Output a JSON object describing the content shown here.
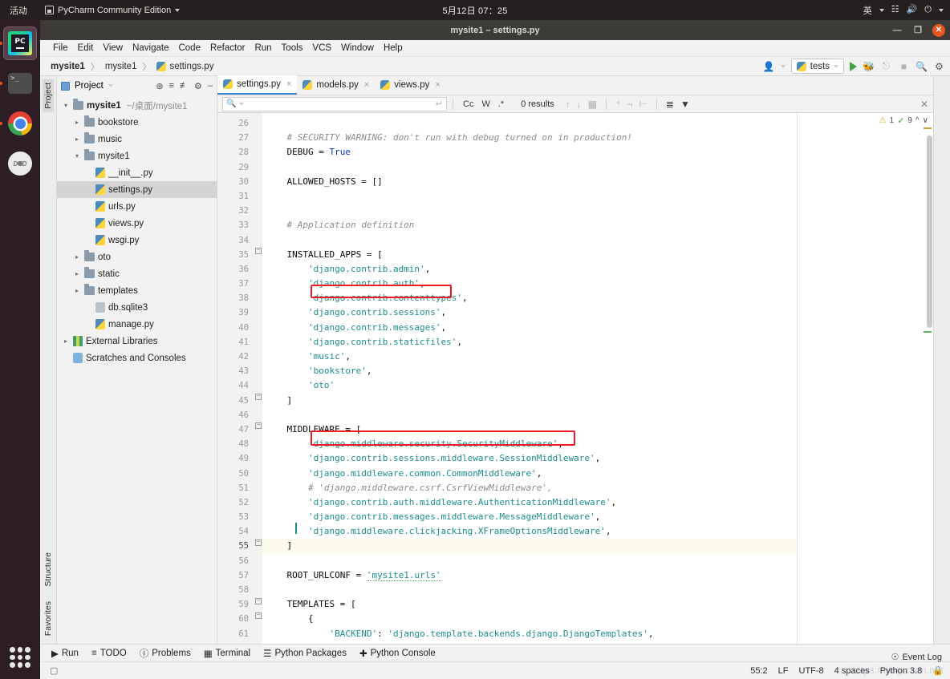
{
  "desktop": {
    "activities": "活动",
    "app_menu": "PyCharm Community Edition",
    "clock": "5月12日 07：25",
    "input_method": "英",
    "dock": [
      {
        "name": "pycharm",
        "label": "PC"
      },
      {
        "name": "terminal",
        "label": ">_"
      },
      {
        "name": "chrome",
        "label": ""
      },
      {
        "name": "dvd",
        "label": "DVD"
      }
    ]
  },
  "window": {
    "title": "mysite1 – settings.py",
    "minimize": "—",
    "maximize": "❐",
    "close": "✕"
  },
  "menu": [
    "File",
    "Edit",
    "View",
    "Navigate",
    "Code",
    "Refactor",
    "Run",
    "Tools",
    "VCS",
    "Window",
    "Help"
  ],
  "navbar": {
    "crumbs": [
      "mysite1",
      "mysite1",
      "settings.py"
    ],
    "separator": "〉",
    "run_config": "tests",
    "profile_icon": "user-icon"
  },
  "project": {
    "panel_title": "Project",
    "tree": [
      {
        "indent": 0,
        "arrow": "v",
        "icon": "folder",
        "label": "mysite1",
        "path": "~/桌面/mysite1",
        "bold": true,
        "selected": false
      },
      {
        "indent": 1,
        "arrow": ">",
        "icon": "folder",
        "label": "bookstore",
        "path": "",
        "bold": false,
        "selected": false
      },
      {
        "indent": 1,
        "arrow": ">",
        "icon": "folder",
        "label": "music",
        "path": "",
        "bold": false,
        "selected": false
      },
      {
        "indent": 1,
        "arrow": "v",
        "icon": "folder",
        "label": "mysite1",
        "path": "",
        "bold": false,
        "selected": false
      },
      {
        "indent": 2,
        "arrow": "",
        "icon": "py",
        "label": "__init__.py",
        "path": "",
        "bold": false,
        "selected": false
      },
      {
        "indent": 2,
        "arrow": "",
        "icon": "py",
        "label": "settings.py",
        "path": "",
        "bold": false,
        "selected": true
      },
      {
        "indent": 2,
        "arrow": "",
        "icon": "py",
        "label": "urls.py",
        "path": "",
        "bold": false,
        "selected": false
      },
      {
        "indent": 2,
        "arrow": "",
        "icon": "py",
        "label": "views.py",
        "path": "",
        "bold": false,
        "selected": false
      },
      {
        "indent": 2,
        "arrow": "",
        "icon": "py",
        "label": "wsgi.py",
        "path": "",
        "bold": false,
        "selected": false
      },
      {
        "indent": 1,
        "arrow": ">",
        "icon": "folder",
        "label": "oto",
        "path": "",
        "bold": false,
        "selected": false
      },
      {
        "indent": 1,
        "arrow": ">",
        "icon": "folder",
        "label": "static",
        "path": "",
        "bold": false,
        "selected": false
      },
      {
        "indent": 1,
        "arrow": ">",
        "icon": "folder",
        "label": "templates",
        "path": "",
        "bold": false,
        "selected": false
      },
      {
        "indent": 2,
        "arrow": "",
        "icon": "db",
        "label": "db.sqlite3",
        "path": "",
        "bold": false,
        "selected": false
      },
      {
        "indent": 2,
        "arrow": "",
        "icon": "py",
        "label": "manage.py",
        "path": "",
        "bold": false,
        "selected": false
      },
      {
        "indent": 0,
        "arrow": ">",
        "icon": "lib",
        "label": "External Libraries",
        "path": "",
        "bold": false,
        "selected": false
      },
      {
        "indent": 0,
        "arrow": "",
        "icon": "scr",
        "label": "Scratches and Consoles",
        "path": "",
        "bold": false,
        "selected": false
      }
    ]
  },
  "editor": {
    "tabs": [
      {
        "label": "settings.py",
        "active": true
      },
      {
        "label": "models.py",
        "active": false
      },
      {
        "label": "views.py",
        "active": false
      }
    ],
    "find": {
      "value": "",
      "placeholder": "",
      "match_case": "Cc",
      "words": "W",
      "regex": ".*",
      "results": "0 results"
    },
    "inspection": {
      "warnings": "1",
      "checks": "9"
    },
    "first_line": 26,
    "lines": [
      {
        "n": 26,
        "tokens": []
      },
      {
        "n": 27,
        "tokens": [
          {
            "t": "cmt",
            "v": "    # SECURITY WARNING: don't run with debug turned on in production!"
          }
        ]
      },
      {
        "n": 28,
        "tokens": [
          {
            "t": "plain",
            "v": "    DEBUG = "
          },
          {
            "t": "kw",
            "v": "True"
          }
        ]
      },
      {
        "n": 29,
        "tokens": []
      },
      {
        "n": 30,
        "tokens": [
          {
            "t": "plain",
            "v": "    ALLOWED_HOSTS = []"
          }
        ]
      },
      {
        "n": 31,
        "tokens": []
      },
      {
        "n": 32,
        "tokens": []
      },
      {
        "n": 33,
        "tokens": [
          {
            "t": "cmt",
            "v": "    # Application definition"
          }
        ]
      },
      {
        "n": 34,
        "tokens": []
      },
      {
        "n": 35,
        "tokens": [
          {
            "t": "plain",
            "v": "    INSTALLED_APPS = ["
          }
        ]
      },
      {
        "n": 36,
        "tokens": [
          {
            "t": "str",
            "v": "        'django.contrib.admin'"
          },
          {
            "t": "plain",
            "v": ","
          }
        ]
      },
      {
        "n": 37,
        "tokens": [
          {
            "t": "str",
            "v": "        'django.contrib.auth'"
          },
          {
            "t": "plain",
            "v": ","
          }
        ]
      },
      {
        "n": 38,
        "tokens": [
          {
            "t": "str",
            "v": "        'django.contrib.contenttypes'"
          },
          {
            "t": "plain",
            "v": ","
          }
        ]
      },
      {
        "n": 39,
        "tokens": [
          {
            "t": "str",
            "v": "        'django.contrib.sessions'"
          },
          {
            "t": "plain",
            "v": ","
          }
        ]
      },
      {
        "n": 40,
        "tokens": [
          {
            "t": "str",
            "v": "        'django.contrib.messages'"
          },
          {
            "t": "plain",
            "v": ","
          }
        ]
      },
      {
        "n": 41,
        "tokens": [
          {
            "t": "str",
            "v": "        'django.contrib.staticfiles'"
          },
          {
            "t": "plain",
            "v": ","
          }
        ]
      },
      {
        "n": 42,
        "tokens": [
          {
            "t": "str",
            "v": "        'music'"
          },
          {
            "t": "plain",
            "v": ","
          }
        ]
      },
      {
        "n": 43,
        "tokens": [
          {
            "t": "str",
            "v": "        'bookstore'"
          },
          {
            "t": "plain",
            "v": ","
          }
        ]
      },
      {
        "n": 44,
        "tokens": [
          {
            "t": "str",
            "v": "        'oto'"
          }
        ]
      },
      {
        "n": 45,
        "tokens": [
          {
            "t": "plain",
            "v": "    ]"
          }
        ]
      },
      {
        "n": 46,
        "tokens": []
      },
      {
        "n": 47,
        "tokens": [
          {
            "t": "plain",
            "v": "    MIDDLEWARE = ["
          }
        ]
      },
      {
        "n": 48,
        "tokens": [
          {
            "t": "str",
            "v": "        'django.middleware.security.SecurityMiddleware'"
          },
          {
            "t": "plain",
            "v": ","
          }
        ]
      },
      {
        "n": 49,
        "tokens": [
          {
            "t": "str",
            "v": "        'django.contrib.sessions.middleware.SessionMiddleware'"
          },
          {
            "t": "plain",
            "v": ","
          }
        ]
      },
      {
        "n": 50,
        "tokens": [
          {
            "t": "str",
            "v": "        'django.middleware.common.CommonMiddleware'"
          },
          {
            "t": "plain",
            "v": ","
          }
        ]
      },
      {
        "n": 51,
        "tokens": [
          {
            "t": "cmt",
            "v": "        # 'django.middleware.csrf.CsrfViewMiddleware',"
          }
        ]
      },
      {
        "n": 52,
        "tokens": [
          {
            "t": "str",
            "v": "        'django.contrib.auth.middleware.AuthenticationMiddleware'"
          },
          {
            "t": "plain",
            "v": ","
          }
        ]
      },
      {
        "n": 53,
        "tokens": [
          {
            "t": "str",
            "v": "        'django.contrib.messages.middleware.MessageMiddleware'"
          },
          {
            "t": "plain",
            "v": ","
          }
        ]
      },
      {
        "n": 54,
        "tokens": [
          {
            "t": "str",
            "v": "        'django.middleware.clickjacking.XFrameOptionsMiddleware'"
          },
          {
            "t": "plain",
            "v": ","
          }
        ]
      },
      {
        "n": 55,
        "tokens": [
          {
            "t": "plain",
            "v": "    ]"
          }
        ],
        "current": true
      },
      {
        "n": 56,
        "tokens": []
      },
      {
        "n": 57,
        "tokens": [
          {
            "t": "plain",
            "v": "    ROOT_URLCONF = "
          },
          {
            "t": "urlstr",
            "v": "'mysite1.urls'"
          }
        ]
      },
      {
        "n": 58,
        "tokens": []
      },
      {
        "n": 59,
        "tokens": [
          {
            "t": "plain",
            "v": "    TEMPLATES = ["
          }
        ]
      },
      {
        "n": 60,
        "tokens": [
          {
            "t": "plain",
            "v": "        {"
          }
        ]
      },
      {
        "n": 61,
        "tokens": [
          {
            "t": "str",
            "v": "            'BACKEND'"
          },
          {
            "t": "plain",
            "v": ": "
          },
          {
            "t": "str",
            "v": "'django.template.backends.django.DjangoTemplates'"
          },
          {
            "t": "plain",
            "v": ","
          }
        ]
      }
    ],
    "annotations": [
      {
        "name": "sessions-app-highlight",
        "line": 39,
        "color": "#ee1c25"
      },
      {
        "name": "session-middleware-highlight",
        "line": 49,
        "color": "#ee1c25"
      }
    ]
  },
  "tool_windows": {
    "left_vertical": [
      "Structure",
      "Favorites"
    ],
    "bottom": [
      {
        "label": "Run",
        "icon": "play-icon"
      },
      {
        "label": "TODO",
        "icon": "list-icon"
      },
      {
        "label": "Problems",
        "icon": "error-icon"
      },
      {
        "label": "Terminal",
        "icon": "terminal-icon"
      },
      {
        "label": "Python Packages",
        "icon": "packages-icon"
      },
      {
        "label": "Python Console",
        "icon": "console-icon"
      }
    ]
  },
  "status_bar": {
    "event_log": "Event Log",
    "caret": "55:2",
    "line_sep": "LF",
    "encoding": "UTF-8",
    "indent": "4 spaces",
    "interpreter": "Python 3.8",
    "watermark": "https://blog.csdn.net"
  }
}
